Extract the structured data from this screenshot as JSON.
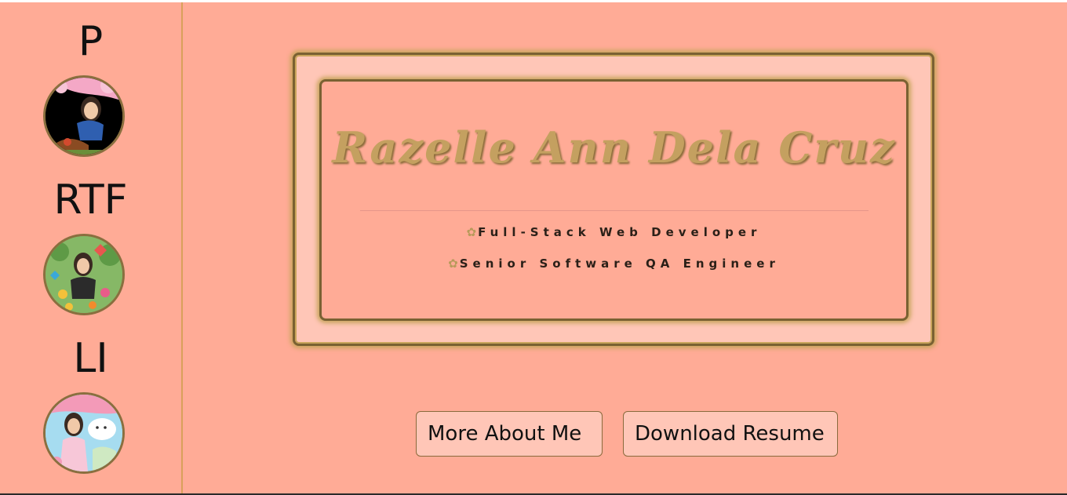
{
  "sidebar": {
    "items": [
      {
        "label": "P"
      },
      {
        "label": "RTF"
      },
      {
        "label": "LI"
      }
    ]
  },
  "hero": {
    "name": "Razelle Ann Dela Cruz",
    "roles": [
      "Full-Stack Web Developer",
      "Senior Software QA Engineer"
    ]
  },
  "actions": {
    "about_label": "More About Me",
    "resume_label": "Download Resume"
  },
  "colors": {
    "background": "#ffab96",
    "frame_light": "#ffc6b7",
    "gold": "#c4a060",
    "border": "#7a6132"
  }
}
